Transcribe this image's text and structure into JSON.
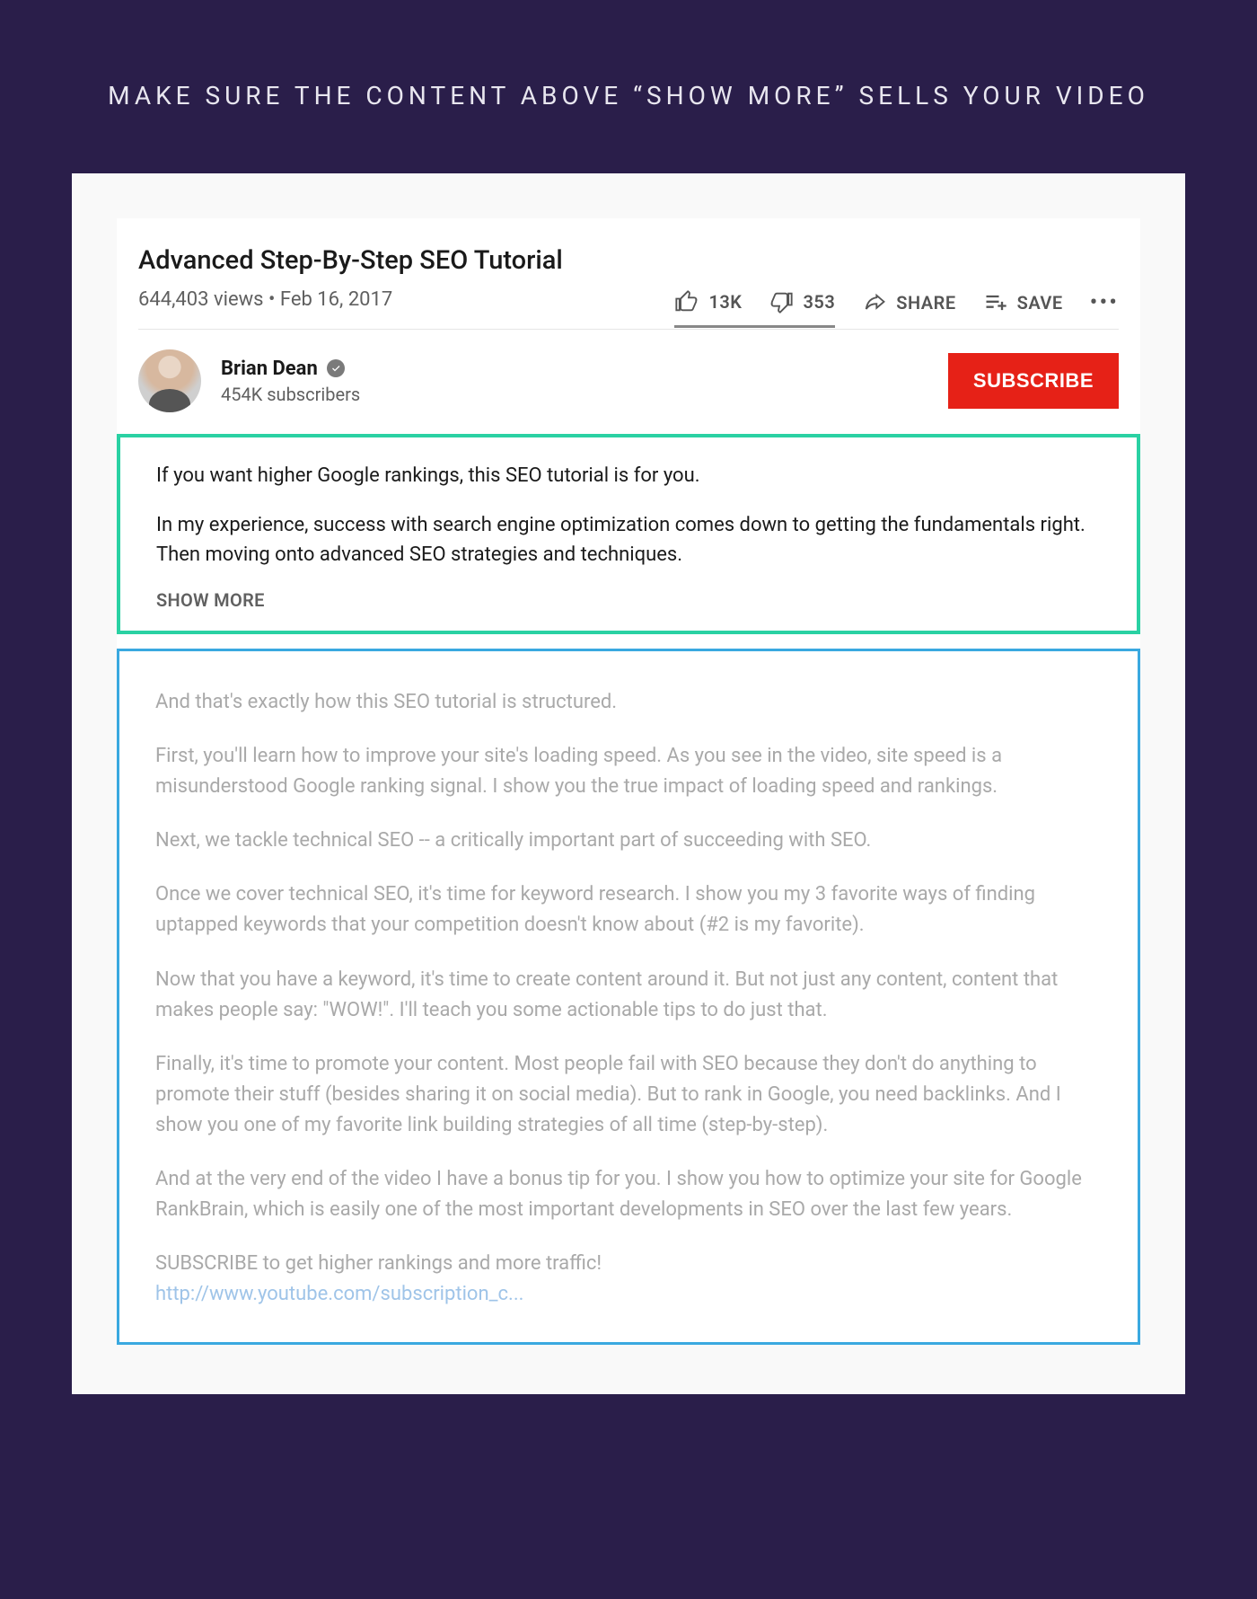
{
  "headline": "MAKE SURE THE CONTENT ABOVE “SHOW MORE” SELLS YOUR VIDEO",
  "video": {
    "title": "Advanced Step-By-Step SEO Tutorial",
    "views": "644,403 views",
    "date": "Feb 16, 2017",
    "likes": "13K",
    "dislikes": "353",
    "share_label": "SHARE",
    "save_label": "SAVE"
  },
  "channel": {
    "name": "Brian Dean",
    "subscribers": "454K subscribers",
    "subscribe_label": "SUBSCRIBE"
  },
  "description": {
    "visible_p1": "If you want higher Google rankings, this SEO tutorial is for you.",
    "visible_p2": "In my experience, success with search engine optimization comes down to getting the fundamentals right. Then moving onto advanced SEO strategies and techniques.",
    "show_more_label": "SHOW MORE",
    "hidden_p1": "And that's exactly how this SEO tutorial is structured.",
    "hidden_p2": "First, you'll learn how to improve your site's loading speed. As you see in the video, site speed is a misunderstood Google ranking signal. I show you the true impact of loading speed and rankings.",
    "hidden_p3": "Next, we tackle technical SEO -- a critically important part of succeeding with SEO.",
    "hidden_p4": "Once we cover technical SEO, it's time for keyword research. I show you my 3 favorite ways of finding uptapped keywords that your competition doesn't know about (#2 is my favorite).",
    "hidden_p5": "Now that you have a keyword, it's time to create content around it. But not just any content, content that makes people say: \"WOW!\". I'll teach you some actionable tips to do just that.",
    "hidden_p6": "Finally, it's time to promote your content. Most people fail with SEO because they don't do anything to promote their stuff (besides sharing it on social media). But to rank in Google, you need backlinks. And I show you one of my favorite link building strategies of all time (step-by-step).",
    "hidden_p7": "And at the very end of the video I have a bonus tip for you. I show you how to optimize your site for Google RankBrain, which is easily one of the most important developments in SEO over the last few years.",
    "hidden_cta": "SUBSCRIBE to get higher rankings and more traffic!",
    "hidden_link": "http://www.youtube.com/subscription_c..."
  }
}
